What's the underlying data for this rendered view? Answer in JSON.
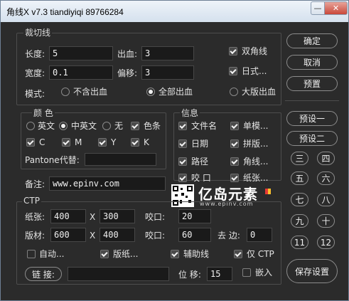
{
  "window": {
    "title": "角线X v7.3 tiandiyiqi 89766284",
    "minimize": "—",
    "close": "✕"
  },
  "cut_group": {
    "title": "裁切线",
    "length_label": "长度:",
    "length_value": "5",
    "width_label": "宽度:",
    "width_value": "0.1",
    "bleed_label": "出血:",
    "bleed_value": "3",
    "offset_label": "偏移:",
    "offset_value": "3",
    "double_corner": "双角线",
    "japanese": "日式...",
    "mode_label": "模式:",
    "mode_none": "不含出血",
    "mode_all": "全部出血",
    "mode_big": "大版出血"
  },
  "color_group": {
    "title": "颜  色",
    "en": "英文",
    "zh_en": "中英文",
    "none": "无",
    "color_bar": "色条",
    "c": "C",
    "m": "M",
    "y": "Y",
    "k": "K",
    "pantone_label": "Pantone代替:",
    "pantone_value": ""
  },
  "info_group": {
    "title": "信息",
    "filename": "文件名",
    "single": "单模...",
    "date": "日期",
    "imposition": "拼版...",
    "path": "路径",
    "corner": "角线...",
    "bite": "咬  口",
    "paper": "纸张..."
  },
  "note": {
    "label": "备注:",
    "value": "www.epinv.com"
  },
  "ctp_group": {
    "title": "CTP",
    "paper_label": "纸张:",
    "paper_w": "400",
    "paper_h": "300",
    "plate_label": "版材:",
    "plate_w": "600",
    "plate_h": "400",
    "x1": "X",
    "x2": "X",
    "bite1_label": "咬口:",
    "bite1_value": "20",
    "bite2_label": "咬口:",
    "bite2_value": "60",
    "trim_label": "去  边:",
    "trim_value": "0",
    "auto": "自动...",
    "plate_paper": "版纸...",
    "aux_line": "辅助线",
    "only_ctp": "仅 CTP",
    "link_btn": "链  接:",
    "link_value": "",
    "pos_label": "位  移:",
    "pos_value": "15",
    "embed": "嵌入"
  },
  "right_panel": {
    "ok": "确定",
    "cancel": "取消",
    "preset": "预置",
    "preset1": "预设一",
    "preset2": "预设二",
    "nums": [
      "三",
      "四",
      "五",
      "六",
      "七",
      "八",
      "九",
      "十",
      "11",
      "12"
    ],
    "save": "保存设置"
  },
  "watermark": {
    "brand": "亿岛元素",
    "url": "www.epinv.com"
  }
}
